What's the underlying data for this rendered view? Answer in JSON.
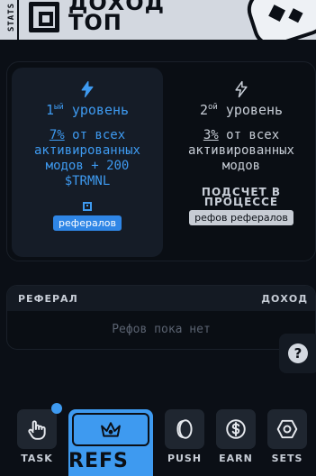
{
  "header": {
    "stats_tab": "STATS",
    "logo_line1": "ДОХОД",
    "logo_line2": "ТОП"
  },
  "levels": [
    {
      "icon": "bolt-icon",
      "level_num": "1",
      "level_sup": "ый",
      "level_word": "уровень",
      "percent": "7%",
      "desc": "от всех активированных модов + 200 $TRMNL",
      "badge": "рефералов",
      "state": "active"
    },
    {
      "icon": "bolt-icon",
      "level_num": "2",
      "level_sup": "ой",
      "level_word": "уровень",
      "percent": "3%",
      "desc": "от всех активированных модов",
      "status": "ПОДСЧЕТ В ПРОЦЕССЕ",
      "badge": "рефов рефералов",
      "state": "inactive"
    }
  ],
  "referrals": {
    "col_referral": "РЕФЕРАЛ",
    "col_income": "ДОХОД",
    "empty_text": "Рефов пока нет"
  },
  "help": {
    "label": "?"
  },
  "nav": {
    "task": "TASK",
    "refs": "REFS",
    "push": "PUSH",
    "earn": "EARN",
    "sets": "SETS"
  },
  "colors": {
    "accent": "#3e9af0",
    "background": "#0b0f16",
    "header": "#d3d8e0"
  }
}
